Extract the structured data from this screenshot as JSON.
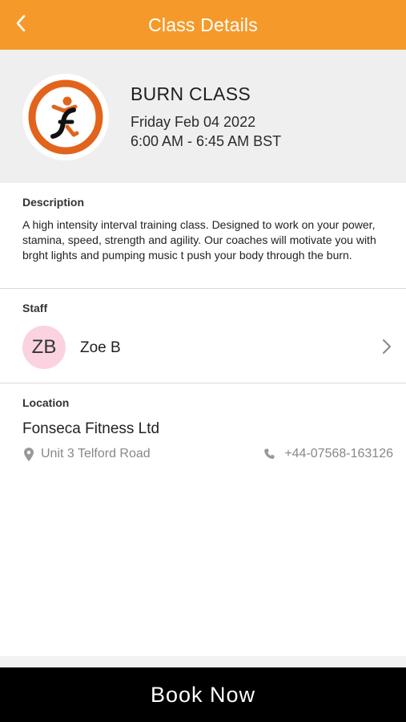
{
  "header": {
    "title": "Class Details",
    "back_icon": "chevron-left-icon"
  },
  "class": {
    "name": "BURN CLASS",
    "date": "Friday Feb 04 2022",
    "time": "6:00 AM - 6:45 AM BST",
    "logo_icon": "fitness-logo-icon"
  },
  "description": {
    "label": "Description",
    "text": "A high intensity interval training class. Designed to work on your power, stamina, speed, strength and agility. Our coaches will motivate you with brght lights and pumping music t push your body through the burn."
  },
  "staff": {
    "label": "Staff",
    "initials": "ZB",
    "name": "Zoe B",
    "chevron_icon": "chevron-right-icon"
  },
  "location": {
    "label": "Location",
    "name": "Fonseca Fitness Ltd",
    "address": "Unit 3 Telford Road",
    "phone": "+44-07568-163126",
    "address_icon": "map-pin-icon",
    "phone_icon": "phone-icon"
  },
  "actions": {
    "book_label": "Book Now"
  },
  "colors": {
    "accent": "#f59a2a",
    "logo_ring": "#e2641c",
    "avatar_bg": "#fbd3e0",
    "book_bg": "#000000"
  }
}
